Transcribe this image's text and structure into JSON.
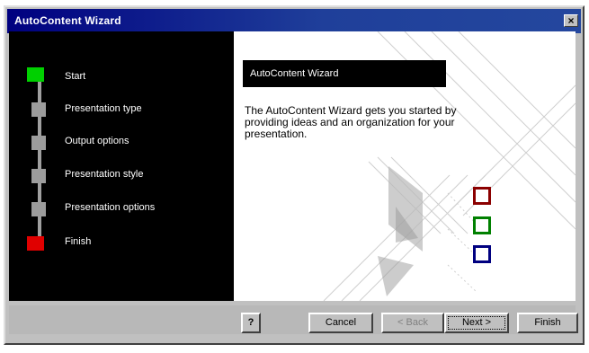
{
  "window": {
    "title": "AutoContent Wizard",
    "close_label": "×"
  },
  "steps": [
    {
      "label": "Start"
    },
    {
      "label": "Presentation type"
    },
    {
      "label": "Output options"
    },
    {
      "label": "Presentation style"
    },
    {
      "label": "Presentation options"
    },
    {
      "label": "Finish"
    }
  ],
  "content": {
    "header": "AutoContent Wizard",
    "description": "The AutoContent Wizard gets you started by providing ideas and an organization for your presentation."
  },
  "buttons": {
    "help": "?",
    "cancel": "Cancel",
    "back": "< Back",
    "next": "Next >",
    "finish": "Finish"
  },
  "colors": {
    "start_marker": "#00d000",
    "finish_marker": "#e00000",
    "box1": "#8b0000",
    "box2": "#008000",
    "box3": "#000080"
  }
}
